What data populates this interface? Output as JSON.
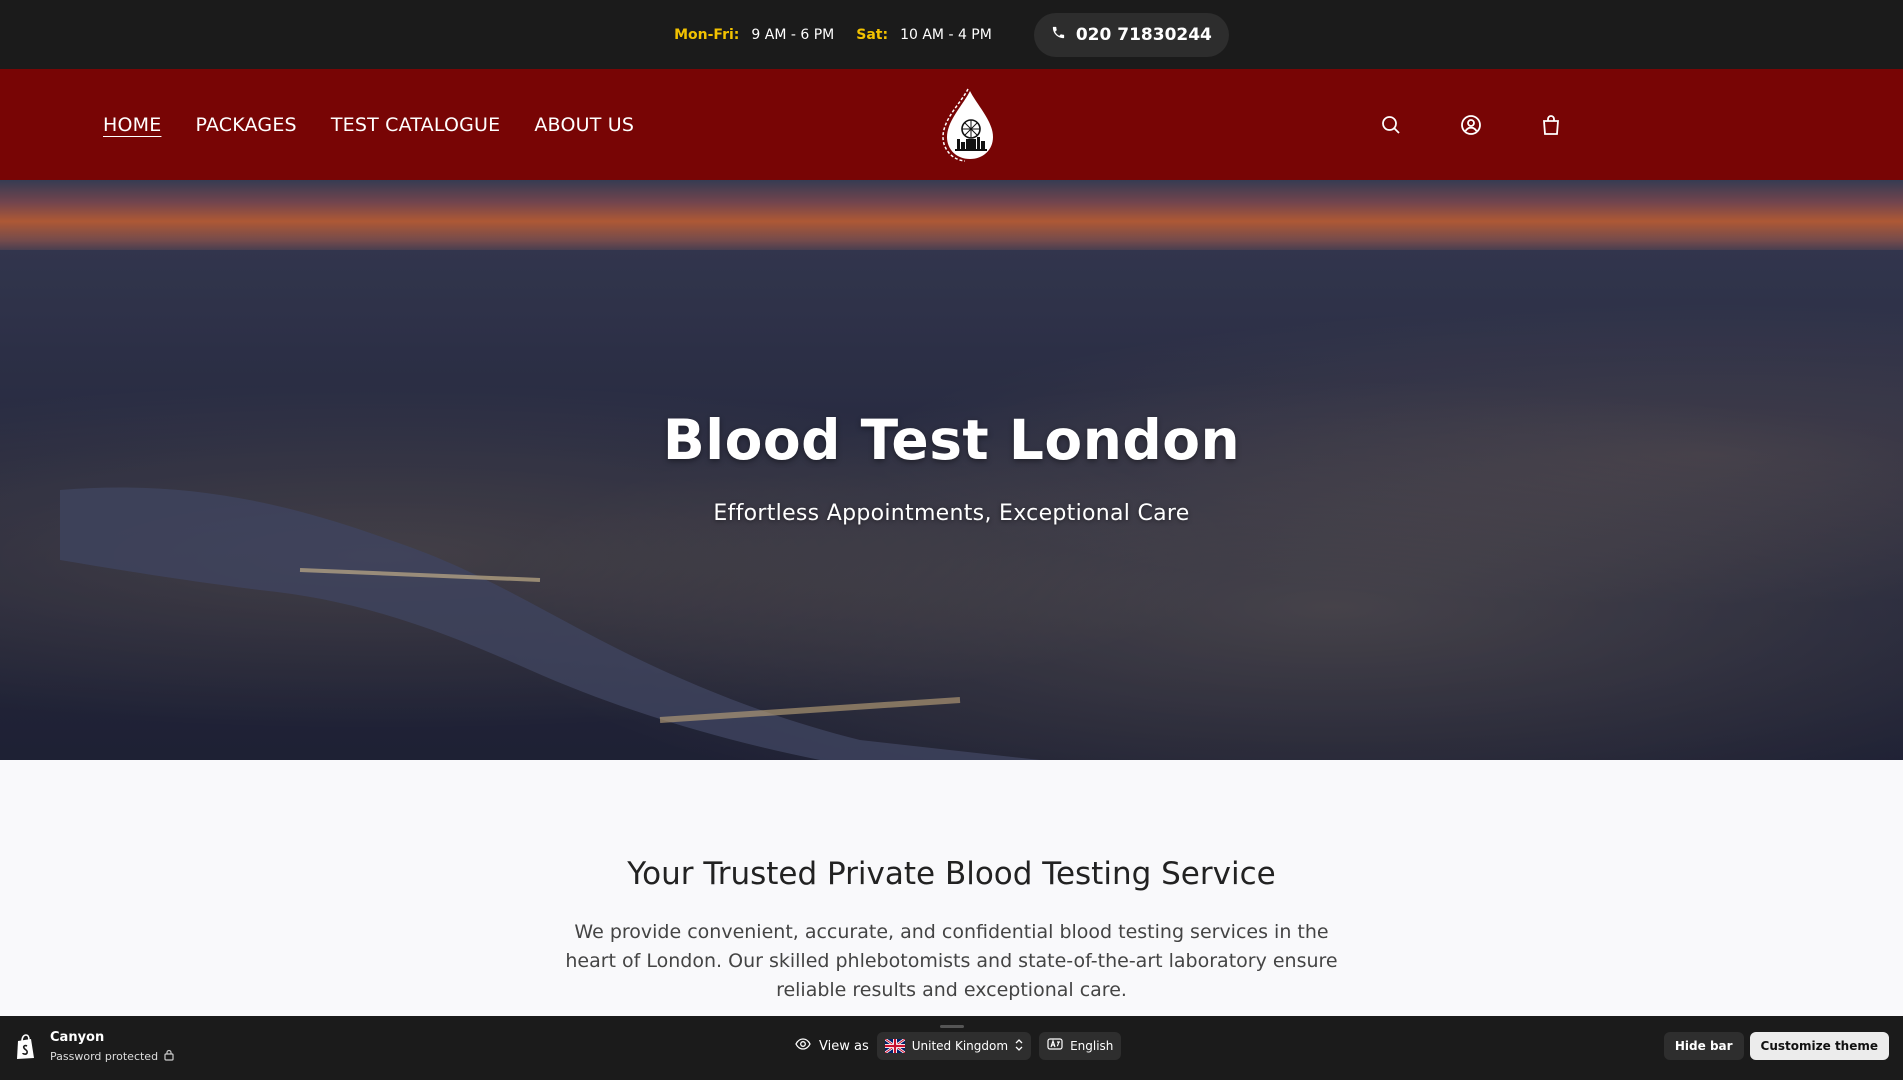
{
  "topbar": {
    "weekday_label": "Mon-Fri:",
    "weekday_hours": "9 AM - 6 PM",
    "saturday_label": "Sat:",
    "saturday_hours": "10 AM - 4 PM",
    "phone": "020 71830244"
  },
  "nav": {
    "items": [
      {
        "label": "HOME",
        "active": true
      },
      {
        "label": "PACKAGES"
      },
      {
        "label": "TEST CATALOGUE"
      },
      {
        "label": "ABOUT US"
      }
    ]
  },
  "header_icons": [
    "search-icon",
    "account-icon",
    "cart-icon"
  ],
  "hero": {
    "title": "Blood Test London",
    "subtitle": "Effortless Appointments, Exceptional Care"
  },
  "intro": {
    "heading": "Your Trusted Private Blood Testing Service",
    "body": "We provide convenient, accurate, and confidential blood testing services in the heart of London. Our skilled phlebotomists and state-of-the-art laboratory ensure reliable results and exceptional care."
  },
  "preview_bar": {
    "store_name": "Canyon",
    "store_status": "Password protected",
    "view_as_label": "View as",
    "country": "United Kingdom",
    "language": "English",
    "hide_bar": "Hide bar",
    "customize": "Customize theme"
  },
  "colors": {
    "header_bg": "#780505",
    "topbar_bg": "#1b1b1b",
    "hours_label": "#f2c200"
  }
}
